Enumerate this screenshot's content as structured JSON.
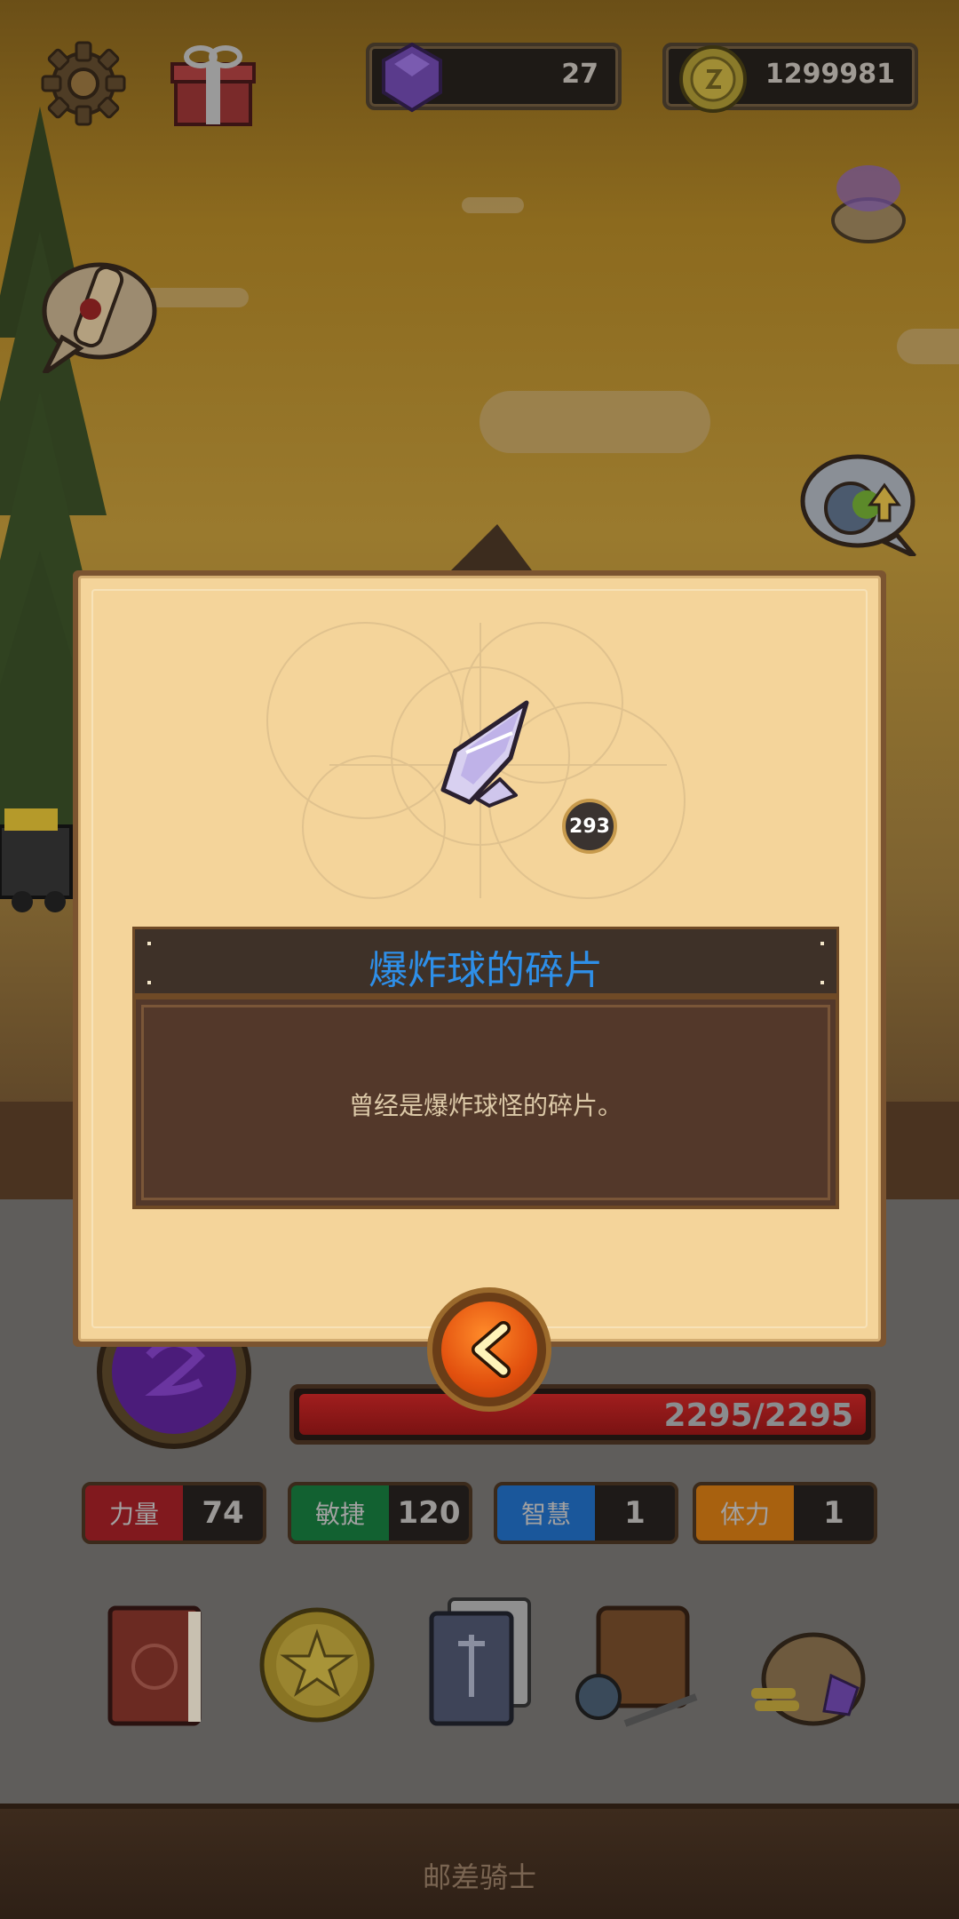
{
  "hud": {
    "gems": "27",
    "coins": "1299981"
  },
  "item": {
    "name": "爆炸球的碎片",
    "count": "293",
    "description": "曾经是爆炸球怪的碎片。"
  },
  "player": {
    "hp": "2295/2295",
    "hp_fraction": 1.0
  },
  "stats": [
    {
      "name": "力量",
      "value": "74",
      "color": "#a31a21"
    },
    {
      "name": "敏捷",
      "value": "120",
      "color": "#0f7a3a"
    },
    {
      "name": "智慧",
      "value": "1",
      "color": "#1a6cc7"
    },
    {
      "name": "体力",
      "value": "1",
      "color": "#d77a0c"
    }
  ],
  "bottom_bar": {
    "label": "邮差骑士"
  },
  "colors": {
    "title_blue": "#2e8fe8",
    "parchment": "#f4d49a",
    "back_button": "#e2500e"
  }
}
